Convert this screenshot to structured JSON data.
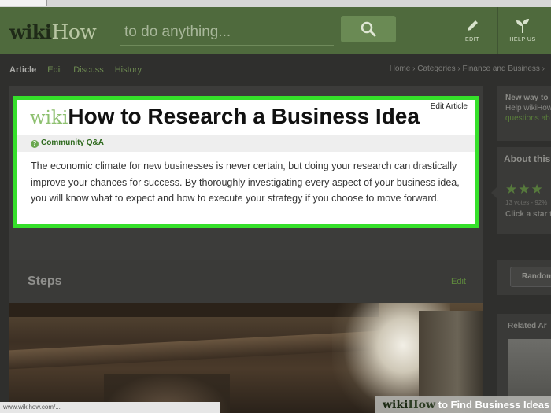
{
  "browser": {
    "tab_label": ""
  },
  "header": {
    "logo_part1": "wiki",
    "logo_part2": "How",
    "search_placeholder": "to do anything...",
    "edit_label": "EDIT",
    "help_label": "HELP US"
  },
  "nav": {
    "tabs": [
      "Article",
      "Edit",
      "Discuss",
      "History"
    ],
    "breadcrumb": "Home › Categories › Finance and Business ›"
  },
  "article": {
    "title_prefix": "wiki",
    "title": "How to Research a Business Idea",
    "edit_link": "Edit Article",
    "community_qa": "Community Q&A",
    "intro": "The economic climate for new businesses is never certain, but doing your research can drastically improve your chances for success. By thoroughly investigating every aspect of your business idea, you will know what to expect and how to execute your strategy if you choose to move forward."
  },
  "steps": {
    "title": "Steps",
    "edit": "Edit"
  },
  "sidebar": {
    "new_way_title": "New way to",
    "new_way_text": "Help wikiHow",
    "new_way_link": "questions ab",
    "about_title": "About this",
    "stars": "★★★",
    "votes": "13 votes - 92%",
    "click_star": "Click a star t",
    "random_button": "Random",
    "related_title": "Related Ar"
  },
  "footer": {
    "status_url": "www.wikihow.com/...",
    "watermark_part1": "wiki",
    "watermark_part2": "How",
    "watermark_part3": " to Find Business Ideas"
  },
  "colors": {
    "highlight_border": "#35e02a",
    "header_green": "#4f6a3d",
    "link_green": "#5f8a3d"
  }
}
